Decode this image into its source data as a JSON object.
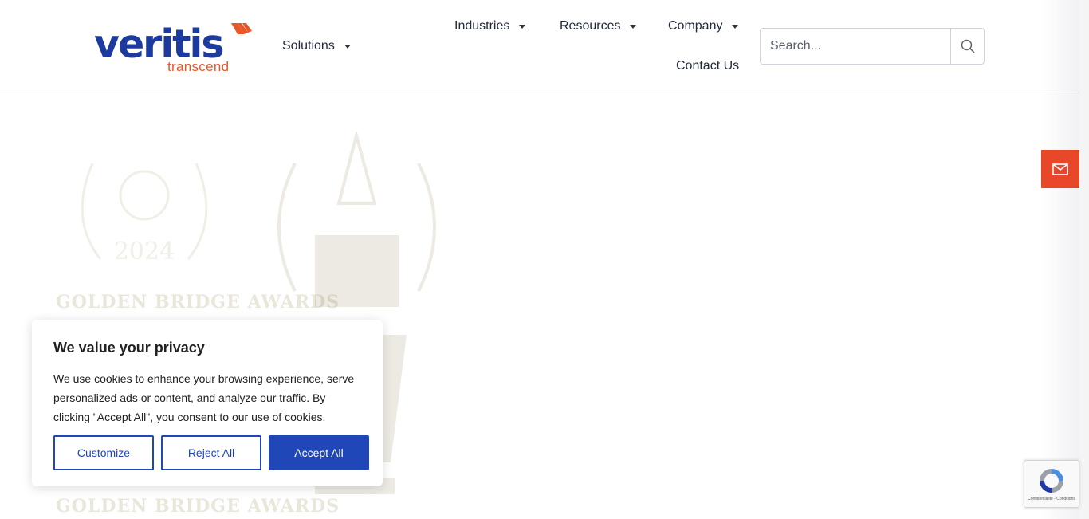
{
  "brand": {
    "name": "veritis",
    "tagline": "transcend",
    "primary_color": "#1d3b9e",
    "accent_color": "#e8572a"
  },
  "nav": {
    "solutions": "Solutions",
    "industries": "Industries",
    "resources": "Resources",
    "company": "Company",
    "contact": "Contact Us"
  },
  "search": {
    "placeholder": "Search..."
  },
  "cookie": {
    "title": "We value your privacy",
    "body": "We use cookies to enhance your browsing experience, serve personalized ads or content, and analyze our traffic. By clicking \"Accept All\", you consent to our use of cookies.",
    "customize": "Customize",
    "reject": "Reject All",
    "accept": "Accept All",
    "button_color": "#1f47b8"
  },
  "recaptcha": {
    "footer": "Confidentialité - Conditions"
  },
  "contact_tab": {
    "icon": "envelope-icon",
    "color": "#e8472a"
  }
}
